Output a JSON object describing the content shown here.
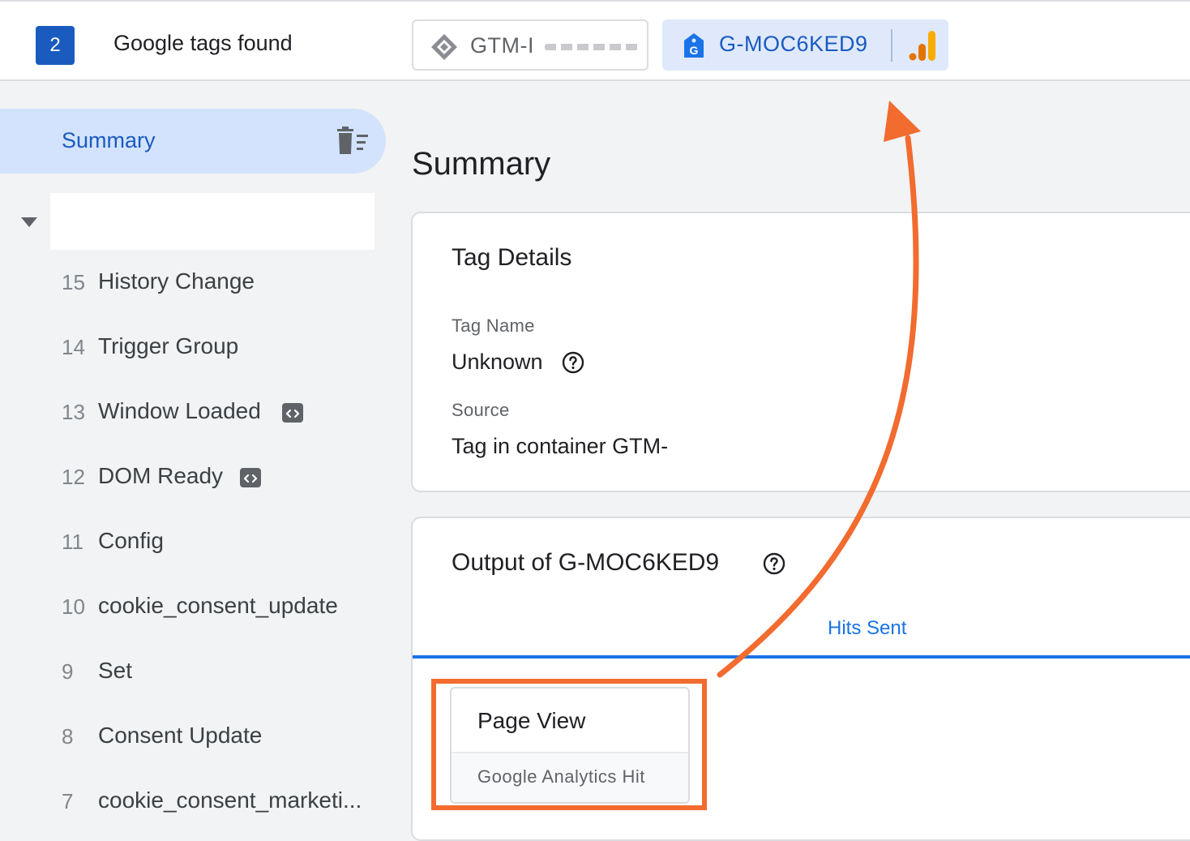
{
  "header": {
    "tag_count": "2",
    "tags_found_label": "Google tags found",
    "tabs": [
      {
        "label": "GTM-I",
        "icon": "gtm-diamond-icon"
      },
      {
        "label": "G-MOC6KED9",
        "icon": "google-tag-icon",
        "badge_icon": "analytics-bars-icon",
        "active": true
      }
    ]
  },
  "sidebar": {
    "summary_label": "Summary",
    "summary_action_icon": "clear-list-icon",
    "events": [
      {
        "num": "15",
        "name": "History Change"
      },
      {
        "num": "14",
        "name": "Trigger Group"
      },
      {
        "num": "13",
        "name": "Window Loaded",
        "icon": "code-icon"
      },
      {
        "num": "12",
        "name": "DOM Ready",
        "icon": "code-icon"
      },
      {
        "num": "11",
        "name": "Config"
      },
      {
        "num": "10",
        "name": "cookie_consent_update"
      },
      {
        "num": "9",
        "name": "Set"
      },
      {
        "num": "8",
        "name": "Consent Update"
      },
      {
        "num": "7",
        "name": "cookie_consent_marketi..."
      }
    ]
  },
  "main": {
    "title": "Summary",
    "tag_details": {
      "title": "Tag Details",
      "tag_name_label": "Tag Name",
      "tag_name_value": "Unknown",
      "source_label": "Source",
      "source_value": "Tag in container GTM-"
    },
    "output": {
      "title": "Output of G-MOC6KED9",
      "tab_label": "Hits Sent",
      "hits": [
        {
          "name": "Page View",
          "type": "Google Analytics Hit"
        }
      ]
    }
  },
  "colors": {
    "accent_blue": "#1a73e8",
    "brand_blue": "#1a5bc0",
    "annotation_orange": "#f26b2f",
    "analytics_orange": "#f9ab00"
  }
}
